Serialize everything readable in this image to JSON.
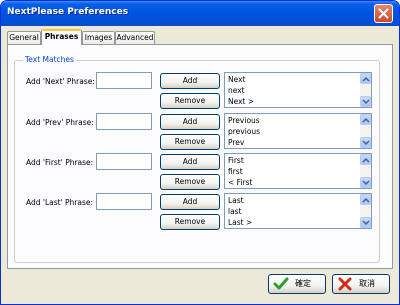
{
  "window": {
    "title": "NextPlease Preferences"
  },
  "tabs": [
    "General",
    "Phrases",
    "Images",
    "Advanced"
  ],
  "group": {
    "title": "Text Matches"
  },
  "rows": [
    {
      "label": "Add 'Next' Phrase:",
      "input_value": "",
      "add_label": "Add",
      "remove_label": "Remove",
      "items": [
        "Next",
        "next",
        "Next >"
      ]
    },
    {
      "label": "Add 'Prev' Phrase:",
      "input_value": "",
      "add_label": "Add",
      "remove_label": "Remove",
      "items": [
        "Previous",
        "previous",
        "Prev"
      ]
    },
    {
      "label": "Add 'First' Phrase:",
      "input_value": "",
      "add_label": "Add",
      "remove_label": "Remove",
      "items": [
        "First",
        "first",
        "< First"
      ]
    },
    {
      "label": "Add 'Last' Phrase:",
      "input_value": "",
      "add_label": "Add",
      "remove_label": "Remove",
      "items": [
        "Last",
        "last",
        "Last >"
      ]
    }
  ],
  "footer": {
    "ok_label": "確定",
    "cancel_label": "取消"
  },
  "icons": {
    "close": "close-icon",
    "ok": "checkmark-icon",
    "cancel": "x-icon",
    "scroll_up": "scroll-up-arrow-icon",
    "scroll_down": "scroll-down-arrow-icon"
  },
  "colors": {
    "titlebar": "#0054e3",
    "face": "#ece9d8",
    "group_title": "#0046d5",
    "active_tab_accent": "#ffc83c"
  }
}
